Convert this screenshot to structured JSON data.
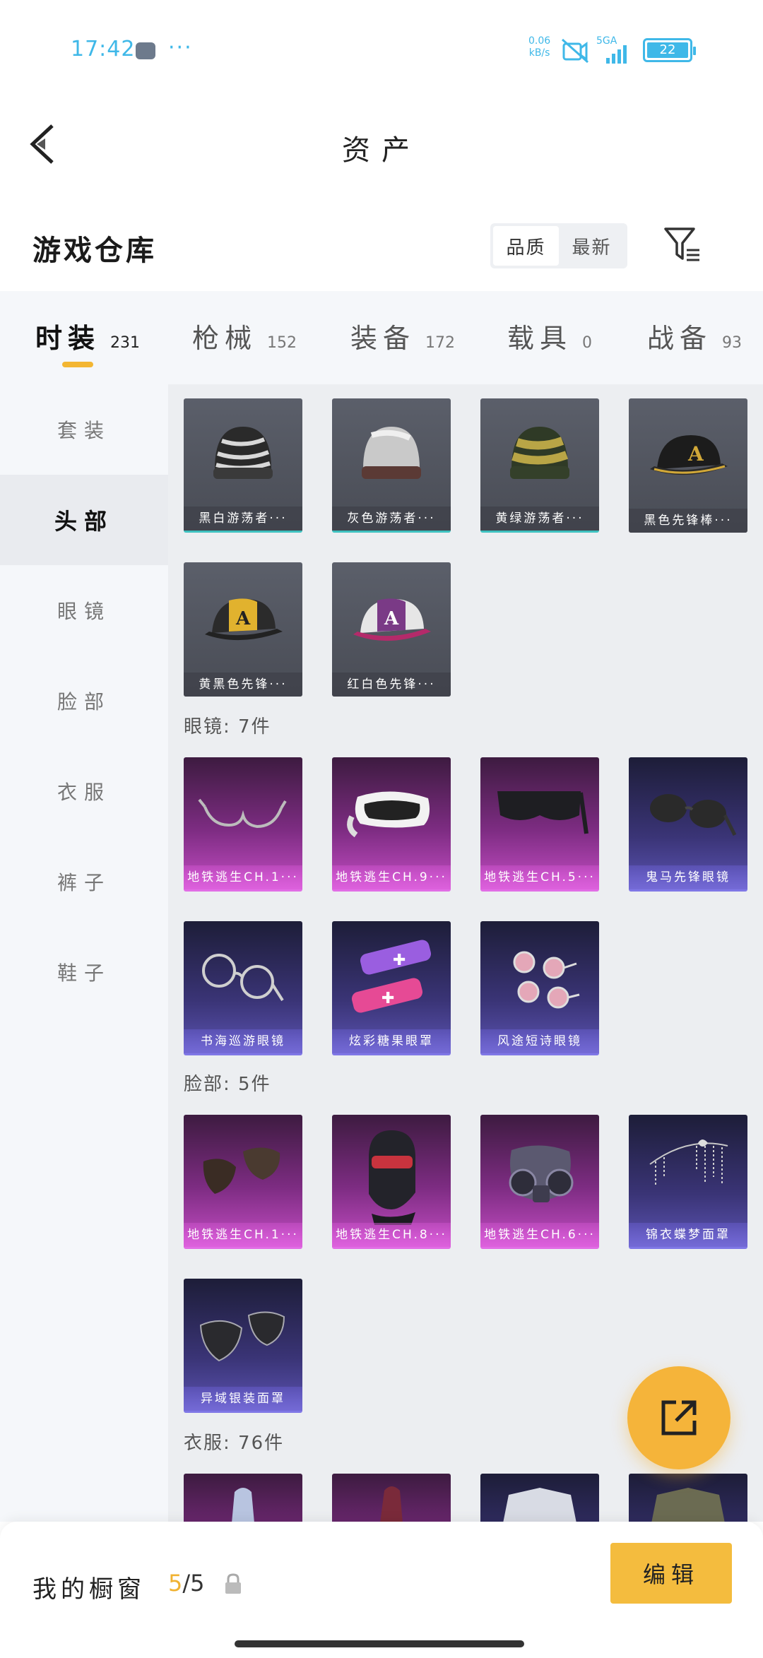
{
  "status_bar": {
    "time": "17:42",
    "dots": "···",
    "speed_value": "0.06",
    "speed_unit": "kB/s",
    "network": "5GA",
    "battery": "22"
  },
  "nav": {
    "title": "资产"
  },
  "warehouse": {
    "title": "游戏仓库",
    "sort_options": [
      "品质",
      "最新"
    ]
  },
  "tabs": [
    {
      "label": "时装",
      "count": "231",
      "active": true
    },
    {
      "label": "枪械",
      "count": "152"
    },
    {
      "label": "装备",
      "count": "172"
    },
    {
      "label": "载具",
      "count": "0"
    },
    {
      "label": "战备",
      "count": "93"
    }
  ],
  "sidebar": {
    "items": [
      "套装",
      "头部",
      "眼镜",
      "脸部",
      "衣服",
      "裤子",
      "鞋子"
    ],
    "active": "头部"
  },
  "sections": {
    "head": {
      "items": [
        {
          "name": "黑白游荡者···",
          "icon": "beanie-zebra-icon"
        },
        {
          "name": "灰色游荡者···",
          "icon": "beanie-grey-icon"
        },
        {
          "name": "黄绿游荡者···",
          "icon": "beanie-striped-icon"
        },
        {
          "name": "黑色先锋棒···",
          "icon": "cap-black-icon"
        },
        {
          "name": "黄黑色先锋···",
          "icon": "cap-yellow-icon"
        },
        {
          "name": "红白色先锋···",
          "icon": "cap-pink-icon"
        }
      ]
    },
    "glasses": {
      "label": "眼镜: 7件",
      "items": [
        {
          "name": "地铁逃生CH.1···",
          "icon": "glasses-frame-icon"
        },
        {
          "name": "地铁逃生CH.9···",
          "icon": "goggles-icon"
        },
        {
          "name": "地铁逃生CH.5···",
          "icon": "shades-icon"
        },
        {
          "name": "鬼马先锋眼镜",
          "icon": "sunglasses-icon"
        },
        {
          "name": "书海巡游眼镜",
          "icon": "round-glasses-icon"
        },
        {
          "name": "炫彩糖果眼罩",
          "icon": "candy-eyemask-icon"
        },
        {
          "name": "风途短诗眼镜",
          "icon": "pink-round-glasses-icon"
        }
      ]
    },
    "face": {
      "label": "脸部: 5件",
      "items": [
        {
          "name": "地铁逃生CH.1···",
          "icon": "face-mask-icon"
        },
        {
          "name": "地铁逃生CH.8···",
          "icon": "balaclava-icon"
        },
        {
          "name": "地铁逃生CH.6···",
          "icon": "gas-mask-icon"
        },
        {
          "name": "锦衣蝶梦面罩",
          "icon": "butterfly-veil-icon"
        },
        {
          "name": "异域银装面罩",
          "icon": "silver-mask-icon"
        }
      ]
    },
    "clothes": {
      "label": "衣服: 76件"
    }
  },
  "bottom_bar": {
    "showcase_label": "我的橱窗",
    "showcase_current": "5",
    "showcase_total": "/5",
    "edit_label": "编辑"
  },
  "colors": {
    "accent": "#f4bc3e",
    "status": "#3fb8e8",
    "magenta_card": "#c44dc4",
    "blue_card": "#5b53b2",
    "grey_card": "#5b5f6a"
  }
}
